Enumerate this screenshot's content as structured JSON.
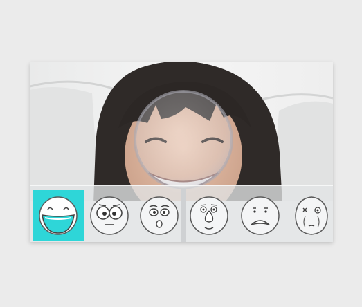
{
  "accent_color": "#2ed6d8",
  "toolbar": {
    "emoji_options": [
      {
        "icon": "laughing-face-icon",
        "selected": true
      },
      {
        "icon": "surprised-face-icon",
        "selected": false
      },
      {
        "icon": "shocked-face-icon",
        "selected": false
      },
      {
        "icon": "big-nose-face-icon",
        "selected": false
      },
      {
        "icon": "sad-face-icon",
        "selected": false
      },
      {
        "icon": "sick-face-icon",
        "selected": false
      }
    ]
  }
}
